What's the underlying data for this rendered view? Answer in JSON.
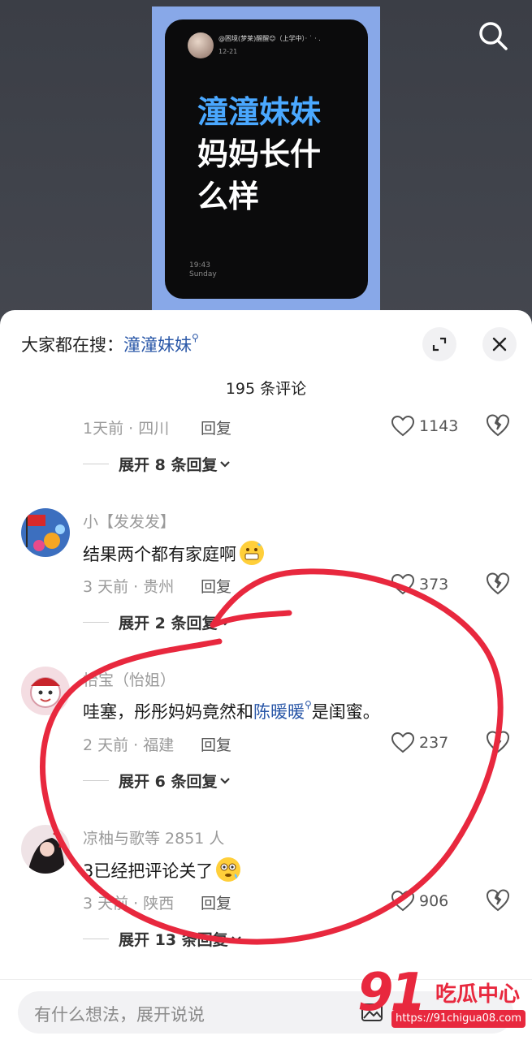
{
  "video": {
    "username": "@困境(梦莱)醒醒😊（上学中）· ˙ · .",
    "date": "12-21",
    "title_line1": "潼潼妹妹",
    "title_line2": "妈妈长什",
    "title_line3": "么样",
    "time": "19:43",
    "day": "Sunday"
  },
  "search_bar": {
    "prefix": "大家都在搜：",
    "keyword": "潼潼妹妹"
  },
  "comments_header": "195 条评论",
  "comments": [
    {
      "meta": "1天前 · 四川",
      "reply": "回复",
      "likes": "1143",
      "expand": "展开 8 条回复"
    },
    {
      "name": "小【发发发】",
      "text": "结果两个都有家庭啊",
      "meta": "3 天前 · 贵州",
      "reply": "回复",
      "likes": "373",
      "expand": "展开 2 条回复"
    },
    {
      "name": "怡宝（怡姐）",
      "text_before": "哇塞，彤彤妈妈竟然和",
      "text_link": "陈暖暖",
      "text_after": "是闺蜜。",
      "meta": "2 天前 · 福建",
      "reply": "回复",
      "likes": "237",
      "expand": "展开 6 条回复"
    },
    {
      "name": "凉柚与歌等 2851 人",
      "text": "3已经把评论关了",
      "meta": "3 天前 · 陕西",
      "reply": "回复",
      "likes": "906",
      "expand": "展开 13 条回复"
    }
  ],
  "input": {
    "placeholder": "有什么想法，展开说说"
  },
  "watermark": {
    "number": "91",
    "text": "吃瓜中心",
    "url": "https://91chigua08.com"
  },
  "colors": {
    "link": "#2b58a8",
    "annotation": "#e8283e",
    "title_accent": "#4aa8ff"
  }
}
